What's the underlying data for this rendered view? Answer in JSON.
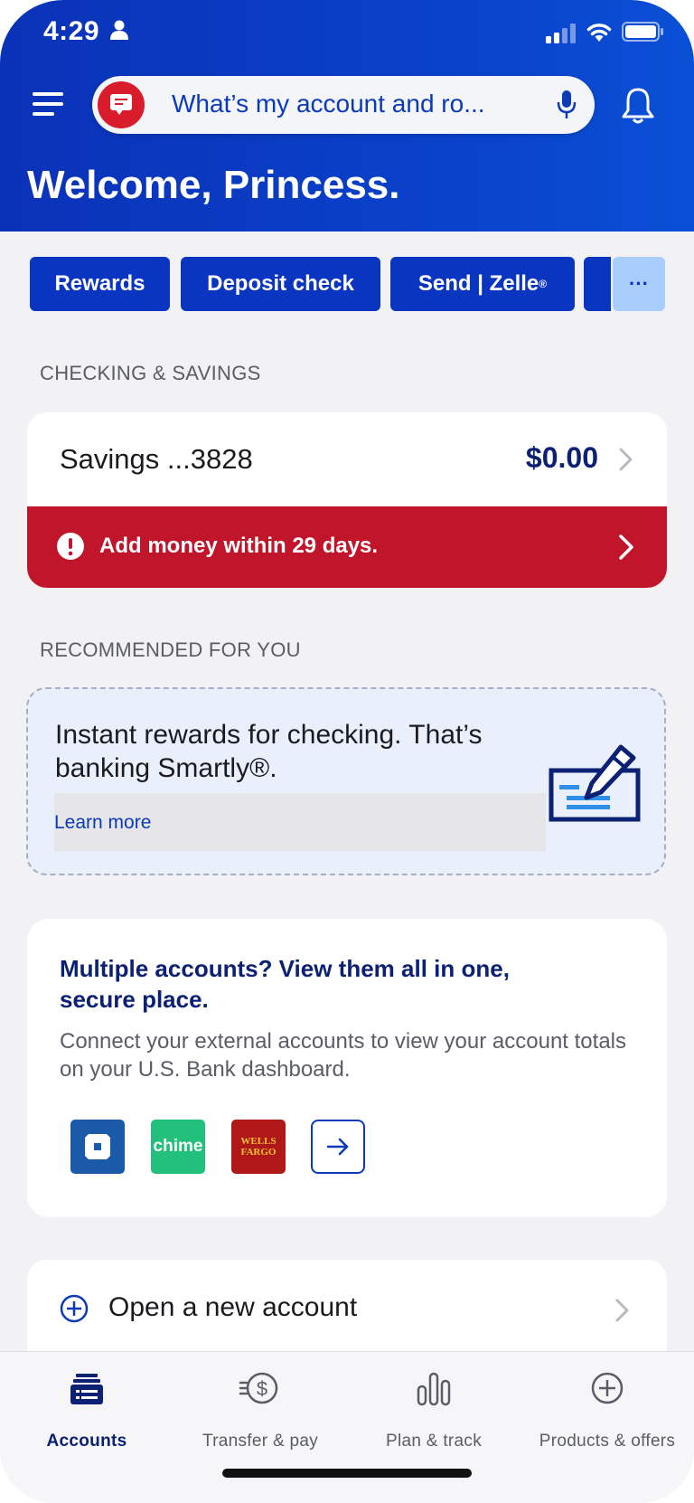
{
  "status_bar": {
    "time": "4:29"
  },
  "header": {
    "search_query": "What’s my account and ro...",
    "welcome": "Welcome, Princess."
  },
  "quick_actions": {
    "rewards": "Rewards",
    "deposit_check": "Deposit check",
    "send_zelle": "Send | Zelle",
    "zelle_mark": "®",
    "more": "···"
  },
  "checking_savings": {
    "section_label": "CHECKING & SAVINGS",
    "account_name": "Savings ...3828",
    "balance": "$0.00",
    "alert": "Add money within 29 days."
  },
  "recommended": {
    "section_label": "RECOMMENDED FOR YOU",
    "promo_text": "Instant rewards for checking. That’s banking Smartly®.",
    "learn_more": "Learn more"
  },
  "external_accounts": {
    "title": "Multiple accounts? View them all in one, secure place.",
    "description": "Connect your external accounts to view your account totals on your U.S. Bank dashboard.",
    "banks": [
      {
        "name": "Chase",
        "icon": "chase-octagon-logo"
      },
      {
        "name": "chime",
        "label": "chime"
      },
      {
        "name": "Wells Fargo",
        "label": "WELLS FARGO"
      }
    ]
  },
  "open_account": {
    "label": "Open a new account"
  },
  "tabs": [
    {
      "label": "Accounts",
      "icon": "accounts-icon",
      "active": true
    },
    {
      "label": "Transfer & pay",
      "icon": "transfer-pay-icon"
    },
    {
      "label": "Plan & track",
      "icon": "plan-track-icon"
    },
    {
      "label": "Products & offers",
      "icon": "products-offers-icon"
    }
  ],
  "colors": {
    "brand_blue": "#0a35c0",
    "navy": "#0c2074",
    "alert_red": "#c0152a",
    "chip_more": "#a9cdfc"
  }
}
